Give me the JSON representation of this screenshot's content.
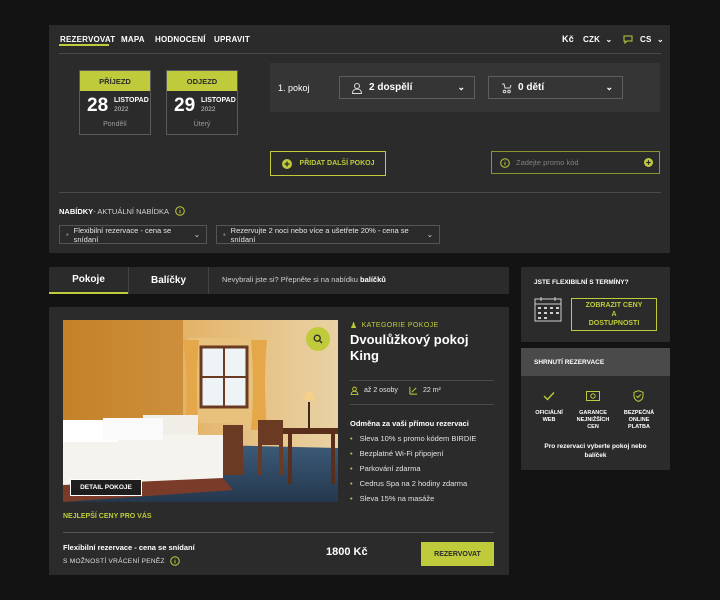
{
  "nav": {
    "items": [
      "REZERVOVAT",
      "MAPA",
      "HODNOCENÍ",
      "UPRAVIT"
    ],
    "currency_symbol": "Kč",
    "currency_code": "CZK",
    "language": "CS"
  },
  "dates": {
    "arrival": {
      "label": "PŘÍJEZD",
      "day": "28",
      "month": "LISTOPAD",
      "year": "2022",
      "weekday": "Pondělí"
    },
    "departure": {
      "label": "ODJEZD",
      "day": "29",
      "month": "LISTOPAD",
      "year": "2022",
      "weekday": "Úterý"
    }
  },
  "room_selector": {
    "room_label": "1. pokoj",
    "adults": "2 dospělí",
    "children": "0 dětí",
    "add_room": "PŘIDAT DALŠÍ POKOJ",
    "promo_placeholder": "Zadejte promo kód"
  },
  "offers": {
    "label_bold": "NABÍDKY",
    "label_rest": " - AKTUÁLNÍ NABÍDKA",
    "select_1": "Flexibilní rezervace - cena se snídaní",
    "select_2": "Rezervujte 2 noci nebo více a ušetřete 20% - cena se snídaní"
  },
  "tabs": {
    "rooms": "Pokoje",
    "packages": "Balíčky",
    "hint_prefix": "Nevybrali jste si? Přepněte si na nabídku ",
    "hint_bold": "balíčků"
  },
  "room": {
    "category": "KATEGORIE POKOJE",
    "name_line1": "Dvoulůžkový pokoj",
    "name_line2": "King",
    "guests": "až 2 osoby",
    "area": "22 m²",
    "reward_title": "Odměna za vaši přímou rezervaci",
    "perks": [
      "Sleva 10% s promo kódem BIRDIE",
      "Bezplatné Wi-Fi připojení",
      "Parkování zdarma",
      "Cedrus Spa na 2 hodiny zdarma",
      "Sleva 15% na masáže"
    ],
    "detail_button": "DETAIL POKOJE",
    "best_price": "NEJLEPŠÍ CENY PRO VÁS",
    "rate_name": "Flexibilní rezervace - cena se snídaní",
    "refund": "S MOŽNOSTÍ VRÁCENÍ PENĚZ",
    "price": "1800 Kč",
    "book_button": "REZERVOVAT"
  },
  "sidebar": {
    "flex_title": "JSTE FLEXIBILNÍ S TERMÍNY?",
    "flex_button": [
      "ZOBRAZIT CENY",
      "A",
      "DOSTUPNOSTI"
    ],
    "summary_title": "SHRNUTÍ REZERVACE",
    "badges": [
      [
        "OFICIÁLNÍ",
        "WEB"
      ],
      [
        "GARANCE",
        "NEJNIŽŠÍCH",
        "CEN"
      ],
      [
        "BEZPEČNÁ",
        "ONLINE",
        "PLATBA"
      ]
    ],
    "hint_line1": "Pro rezervaci vyberte pokoj nebo",
    "hint_line2": "balíček"
  },
  "colors": {
    "accent": "#bfcb3b",
    "panel": "#2b2b2b",
    "background": "#131313"
  }
}
